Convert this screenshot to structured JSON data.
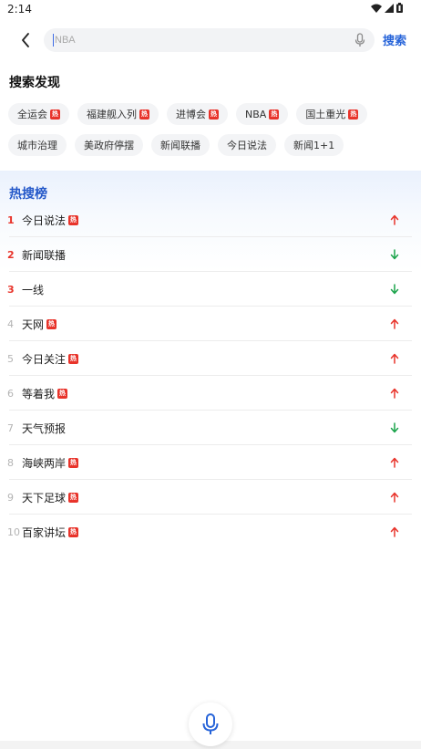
{
  "status": {
    "time": "2:14"
  },
  "search": {
    "placeholder": "NBA",
    "button_label": "搜索"
  },
  "discover": {
    "title": "搜索发现",
    "chips": [
      {
        "label": "全运会",
        "hot": true
      },
      {
        "label": "福建舰入列",
        "hot": true
      },
      {
        "label": "进博会",
        "hot": true
      },
      {
        "label": "NBA",
        "hot": true
      },
      {
        "label": "国土重光",
        "hot": true
      },
      {
        "label": "城市治理",
        "hot": false
      },
      {
        "label": "美政府停摆",
        "hot": false
      },
      {
        "label": "新闻联播",
        "hot": false
      },
      {
        "label": "今日说法",
        "hot": false
      },
      {
        "label": "新闻1+1",
        "hot": false
      }
    ]
  },
  "hot_list": {
    "title": "热搜榜",
    "badge_text": "热",
    "items": [
      {
        "rank": "1",
        "label": "今日说法",
        "hot": true,
        "trend": "up"
      },
      {
        "rank": "2",
        "label": "新闻联播",
        "hot": false,
        "trend": "down"
      },
      {
        "rank": "3",
        "label": "一线",
        "hot": false,
        "trend": "down"
      },
      {
        "rank": "4",
        "label": "天网",
        "hot": true,
        "trend": "up"
      },
      {
        "rank": "5",
        "label": "今日关注",
        "hot": true,
        "trend": "up"
      },
      {
        "rank": "6",
        "label": "等着我",
        "hot": true,
        "trend": "up"
      },
      {
        "rank": "7",
        "label": "天气预报",
        "hot": false,
        "trend": "down"
      },
      {
        "rank": "8",
        "label": "海峡两岸",
        "hot": true,
        "trend": "up"
      },
      {
        "rank": "9",
        "label": "天下足球",
        "hot": true,
        "trend": "up"
      },
      {
        "rank": "10",
        "label": "百家讲坛",
        "hot": true,
        "trend": "up"
      }
    ]
  },
  "colors": {
    "accent": "#2764d9",
    "hot": "#e8332a",
    "up": "#e8332a",
    "down": "#1aa34a"
  },
  "icons": {
    "back": "chevron-left-icon",
    "mic": "microphone-icon",
    "up": "arrow-up-icon",
    "down": "arrow-down-icon"
  }
}
